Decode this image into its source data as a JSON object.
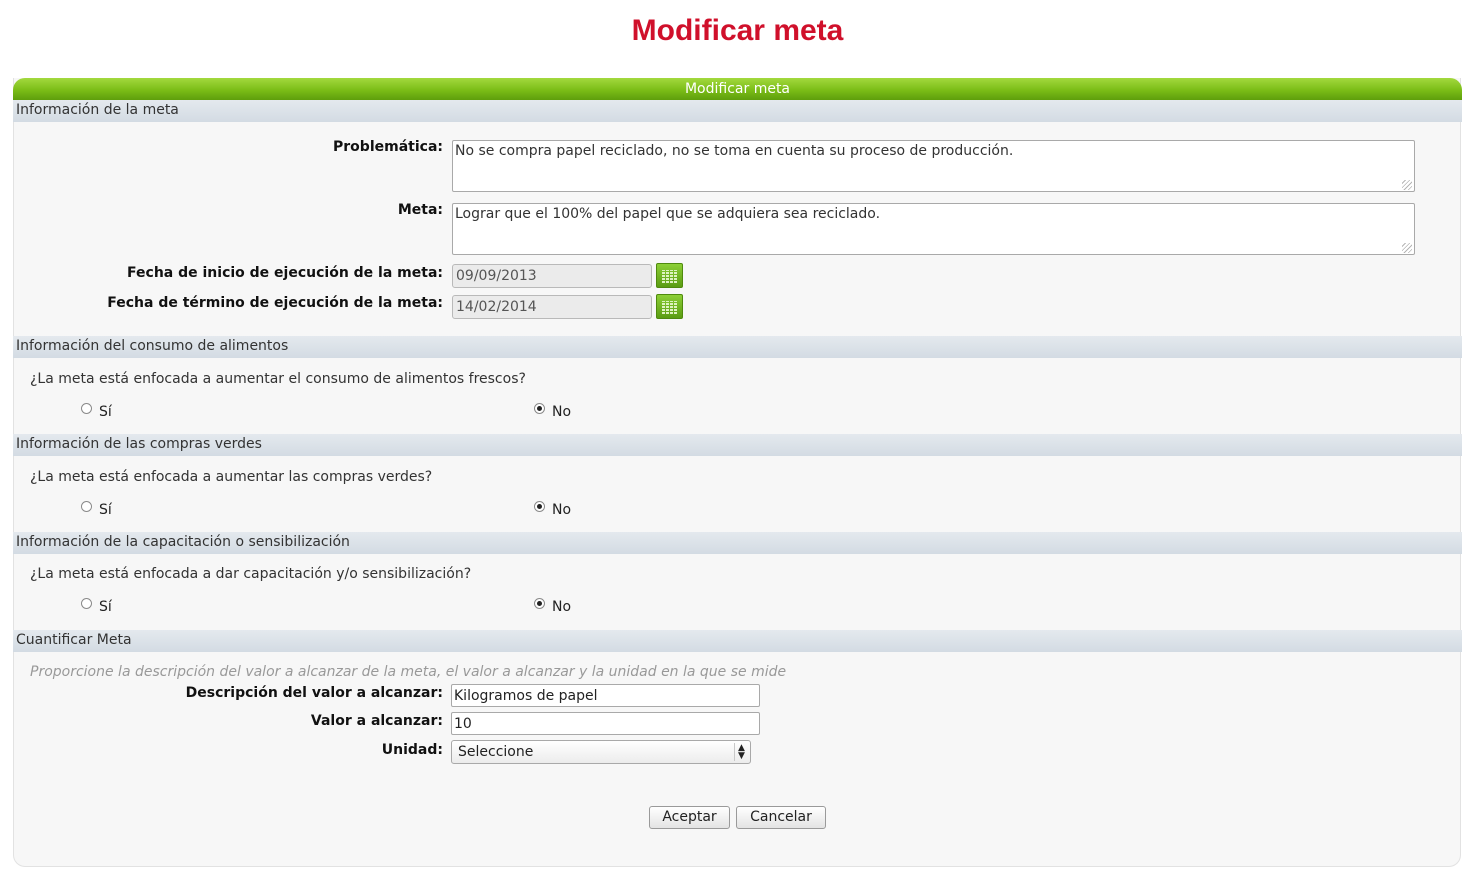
{
  "page": {
    "title": "Modificar meta"
  },
  "panel": {
    "title": "Modificar meta"
  },
  "sections": {
    "meta": "Información de la meta",
    "alimentos": "Información del consumo de alimentos",
    "compras": "Información de las compras verdes",
    "capacitacion": "Información de la capacitación o sensibilización",
    "cuantificar": "Cuantificar Meta"
  },
  "meta": {
    "problematica_label": "Problemática:",
    "problematica_value": "No se compra papel reciclado, no se toma en cuenta su proceso de producción.",
    "meta_label": "Meta:",
    "meta_value": "Lograr que el 100% del papel que se adquiera sea reciclado.",
    "fecha_inicio_label": "Fecha de inicio de ejecución de la meta:",
    "fecha_inicio_value": "09/09/2013",
    "fecha_termino_label": "Fecha de término de ejecución de la meta:",
    "fecha_termino_value": "14/02/2014"
  },
  "alimentos": {
    "question": "¿La meta está enfocada a aumentar el consumo de alimentos frescos?",
    "yes_label": "Sí",
    "no_label": "No",
    "selected": "No"
  },
  "compras": {
    "question": "¿La meta está enfocada a aumentar las compras verdes?",
    "yes_label": "Sí",
    "no_label": "No",
    "selected": "No"
  },
  "capacitacion": {
    "question": "¿La meta está enfocada a dar capacitación y/o sensibilización?",
    "yes_label": "Sí",
    "no_label": "No",
    "selected": "No"
  },
  "cuantificar": {
    "hint": "Proporcione la descripción del valor a alcanzar de la meta, el valor a alcanzar y la unidad en la que se mide",
    "descripcion_label": "Descripción del valor a alcanzar:",
    "descripcion_value": "Kilogramos de papel",
    "valor_label": "Valor a alcanzar:",
    "valor_value": "10",
    "unidad_label": "Unidad:",
    "unidad_value": "Seleccione"
  },
  "buttons": {
    "accept": "Aceptar",
    "cancel": "Cancelar"
  },
  "icons": {
    "calendar": "calendar-icon",
    "select_arrows": "chevron-updown-icon"
  },
  "colors": {
    "title": "#d0102b",
    "header_green": "#7bbd17",
    "section_bar": "#d3dbe3"
  }
}
